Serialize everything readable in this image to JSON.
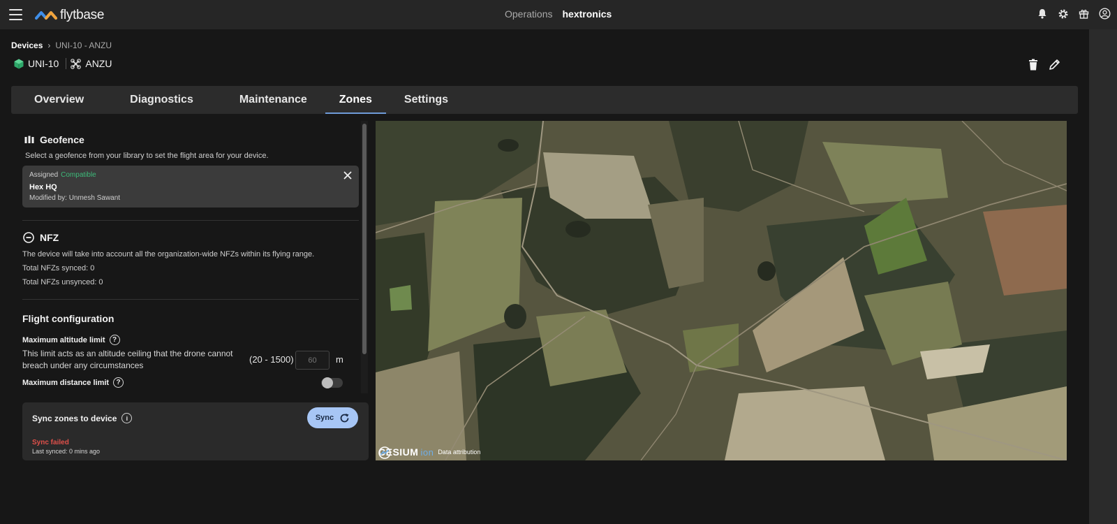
{
  "header": {
    "logo_text": "flytbase",
    "operations_label": "Operations",
    "org_name": "hextronics",
    "icons": [
      "bell-icon",
      "gear-icon",
      "gift-icon",
      "user-icon"
    ]
  },
  "breadcrumb": {
    "root": "Devices",
    "separator": "›",
    "current": "UNI-10 - ANZU"
  },
  "device": {
    "dock_name": "UNI-10",
    "drone_name": "ANZU"
  },
  "tabs": [
    {
      "label": "Overview"
    },
    {
      "label": "Diagnostics"
    },
    {
      "label": "Maintenance"
    },
    {
      "label": "Zones",
      "active": true
    },
    {
      "label": "Settings"
    }
  ],
  "geofence": {
    "title": "Geofence",
    "description": "Select a geofence from your library to set the flight area for your device.",
    "card": {
      "status": "Assigned",
      "compat": "Compatible",
      "name": "Hex HQ",
      "modified": "Modified by: Unmesh Sawant"
    }
  },
  "nfz": {
    "title": "NFZ",
    "description": "The device will take into account all the organization-wide NFZs within its flying range.",
    "synced": "Total NFZs synced: 0",
    "unsynced": "Total NFZs unsynced: 0"
  },
  "flight_config": {
    "title": "Flight configuration",
    "altitude_label": "Maximum altitude limit",
    "altitude_help": "?",
    "altitude_desc": "This limit acts as an altitude ceiling that the drone cannot breach under any circumstances",
    "altitude_range": "(20 - 1500)",
    "altitude_placeholder": "60",
    "altitude_unit": "m",
    "distance_label": "Maximum distance limit",
    "distance_help": "?",
    "distance_enabled": false
  },
  "sync": {
    "title": "Sync zones to device",
    "info": "i",
    "button_label": "Sync",
    "status": "Sync failed",
    "last_synced": "Last synced: 0 mins ago"
  },
  "map": {
    "logo_text": "CESIUM",
    "logo_suffix": "ion",
    "attribution": "Data attribution"
  }
}
